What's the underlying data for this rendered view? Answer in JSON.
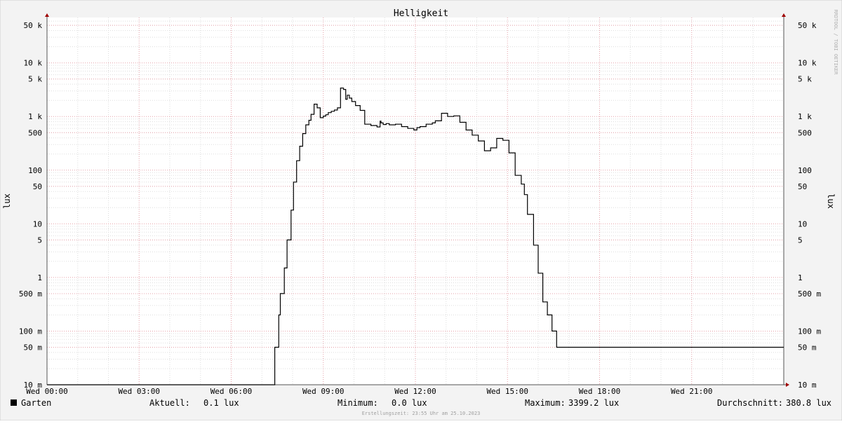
{
  "chart_data": {
    "type": "line",
    "title": "Helligkeit",
    "ylabel": "lux",
    "ylabel_right": "lux",
    "watermark": "RRDTOOL / TOBI OETIKER",
    "y_scale": "log",
    "ylim": [
      0.01,
      70000
    ],
    "x_ticks": [
      "Wed 00:00",
      "Wed 03:00",
      "Wed 06:00",
      "Wed 09:00",
      "Wed 12:00",
      "Wed 15:00",
      "Wed 18:00",
      "Wed 21:00"
    ],
    "x_tick_hours": [
      0,
      3,
      6,
      9,
      12,
      15,
      18,
      21
    ],
    "x_range_hours": [
      0,
      24
    ],
    "y_ticks": [
      {
        "value": 50000,
        "label": "50 k"
      },
      {
        "value": 10000,
        "label": "10 k"
      },
      {
        "value": 5000,
        "label": "5 k"
      },
      {
        "value": 1000,
        "label": "1 k"
      },
      {
        "value": 500,
        "label": "500"
      },
      {
        "value": 100,
        "label": "100"
      },
      {
        "value": 50,
        "label": "50"
      },
      {
        "value": 10,
        "label": "10"
      },
      {
        "value": 5,
        "label": "5"
      },
      {
        "value": 1,
        "label": "1"
      },
      {
        "value": 0.5,
        "label": "500 m"
      },
      {
        "value": 0.1,
        "label": "100 m"
      },
      {
        "value": 0.05,
        "label": "50 m"
      },
      {
        "value": 0.01,
        "label": "10 m"
      }
    ],
    "series": [
      {
        "name": "Garten",
        "color": "#000000",
        "x": [
          0,
          7.4,
          7.42,
          7.55,
          7.6,
          7.73,
          7.82,
          7.95,
          8.03,
          8.13,
          8.23,
          8.33,
          8.43,
          8.53,
          8.6,
          8.7,
          8.8,
          8.9,
          9.0,
          9.08,
          9.16,
          9.26,
          9.36,
          9.46,
          9.56,
          9.66,
          9.73,
          9.78,
          9.85,
          9.93,
          10.05,
          10.2,
          10.35,
          10.55,
          10.75,
          10.85,
          10.88,
          10.95,
          11.05,
          11.15,
          11.35,
          11.55,
          11.75,
          11.95,
          12.05,
          12.15,
          12.35,
          12.55,
          12.65,
          12.85,
          13.05,
          13.25,
          13.45,
          13.65,
          13.85,
          14.05,
          14.25,
          14.45,
          14.65,
          14.85,
          15.05,
          15.25,
          15.45,
          15.55,
          15.65,
          15.85,
          16.0,
          16.15,
          16.3,
          16.45,
          16.6,
          16.75,
          16.9,
          17.05,
          17.15,
          17.35,
          17.45,
          17.6,
          17.75,
          17.85,
          17.95,
          18.05,
          18.15,
          18.3,
          18.4,
          18.5,
          18.6,
          18.7,
          18.8,
          18.9,
          19.0,
          19.1,
          19.2,
          19.5,
          24
        ],
        "values": [
          0.01,
          0.01,
          0.05,
          0.2,
          0.5,
          1.5,
          5,
          18,
          60,
          150,
          280,
          480,
          700,
          850,
          1100,
          1700,
          1450,
          950,
          1020,
          1080,
          1180,
          1250,
          1320,
          1450,
          3400,
          3200,
          2100,
          2500,
          2200,
          1900,
          1600,
          1300,
          720,
          680,
          640,
          820,
          760,
          710,
          740,
          700,
          720,
          650,
          600,
          560,
          620,
          650,
          720,
          760,
          830,
          1150,
          1000,
          1030,
          780,
          560,
          450,
          350,
          230,
          260,
          390,
          360,
          210,
          80,
          55,
          35,
          15,
          4,
          1.2,
          0.35,
          0.2,
          0.1,
          0.05,
          0.05,
          0.05,
          0.05,
          0.05,
          0.05,
          0.05,
          0.05,
          0.05,
          0.05,
          0.05,
          0.05,
          0.05,
          0.05,
          0.05,
          0.05,
          0.05,
          0.05,
          0.05,
          0.05,
          0.05,
          0.05,
          0.05,
          0.05,
          0.05
        ]
      }
    ],
    "grid": true,
    "legend": "bottom"
  },
  "legend": {
    "series_label": "Garten",
    "aktuell_label": "Aktuell:",
    "aktuell_value": "0.1 lux",
    "minimum_label": "Minimum:",
    "minimum_value": "0.0 lux",
    "maximum_label": "Maximum:",
    "maximum_value": "3399.2 lux",
    "durchschnitt_label": "Durchschnitt:",
    "durchschnitt_value": "380.8 lux"
  },
  "footer": "Erstellungszeit: 23:55 Uhr am 25.10.2023"
}
